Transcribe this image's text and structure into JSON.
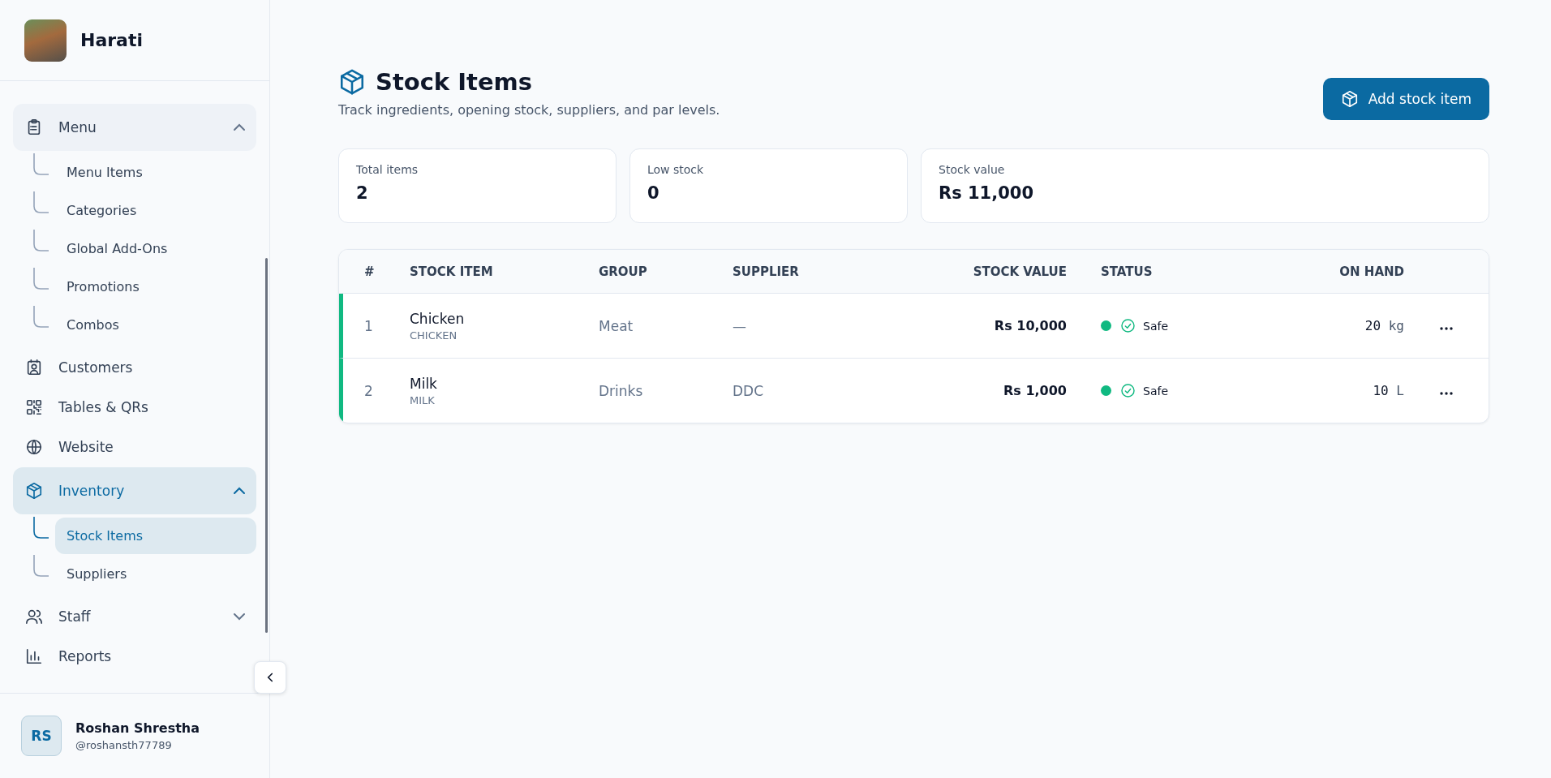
{
  "app": {
    "name": "Harati"
  },
  "sidebar": {
    "items": [
      {
        "kind": "group",
        "label": "Menu",
        "selected": false,
        "expanded": true,
        "children": [
          {
            "label": "Menu Items",
            "selected": false
          },
          {
            "label": "Categories",
            "selected": false
          },
          {
            "label": "Global Add-Ons",
            "selected": false
          },
          {
            "label": "Promotions",
            "selected": false
          },
          {
            "label": "Combos",
            "selected": false
          }
        ]
      },
      {
        "kind": "link",
        "label": "Customers",
        "selected": false
      },
      {
        "kind": "link",
        "label": "Tables & QRs",
        "selected": false
      },
      {
        "kind": "link",
        "label": "Website",
        "selected": false
      },
      {
        "kind": "group",
        "label": "Inventory",
        "selected": true,
        "expanded": true,
        "children": [
          {
            "label": "Stock Items",
            "selected": true
          },
          {
            "label": "Suppliers",
            "selected": false
          }
        ]
      },
      {
        "kind": "group",
        "label": "Staff",
        "selected": false,
        "expanded": false
      },
      {
        "kind": "link",
        "label": "Reports",
        "selected": false
      }
    ]
  },
  "user": {
    "initials": "RS",
    "name": "Roshan Shrestha",
    "handle": "@roshansth77789"
  },
  "page": {
    "title": "Stock Items",
    "subtitle": "Track ingredients, opening stock, suppliers, and par levels.",
    "add_button": "Add stock item"
  },
  "stats": [
    {
      "label": "Total items",
      "value": "2"
    },
    {
      "label": "Low stock",
      "value": "0"
    },
    {
      "label": "Stock value",
      "value": "Rs 11,000"
    }
  ],
  "table": {
    "columns": [
      "#",
      "STOCK ITEM",
      "GROUP",
      "SUPPLIER",
      "STOCK VALUE",
      "STATUS",
      "ON HAND"
    ],
    "rows": [
      {
        "index": "1",
        "name": "Chicken",
        "code": "CHICKEN",
        "group": "Meat",
        "supplier": "—",
        "value": "Rs 10,000",
        "status": {
          "label": "Safe",
          "color": "#10b981"
        },
        "on_hand": "20",
        "unit": "kg"
      },
      {
        "index": "2",
        "name": "Milk",
        "code": "MILK",
        "group": "Drinks",
        "supplier": "DDC",
        "value": "Rs 1,000",
        "status": {
          "label": "Safe",
          "color": "#10b981"
        },
        "on_hand": "10",
        "unit": "L"
      }
    ]
  }
}
